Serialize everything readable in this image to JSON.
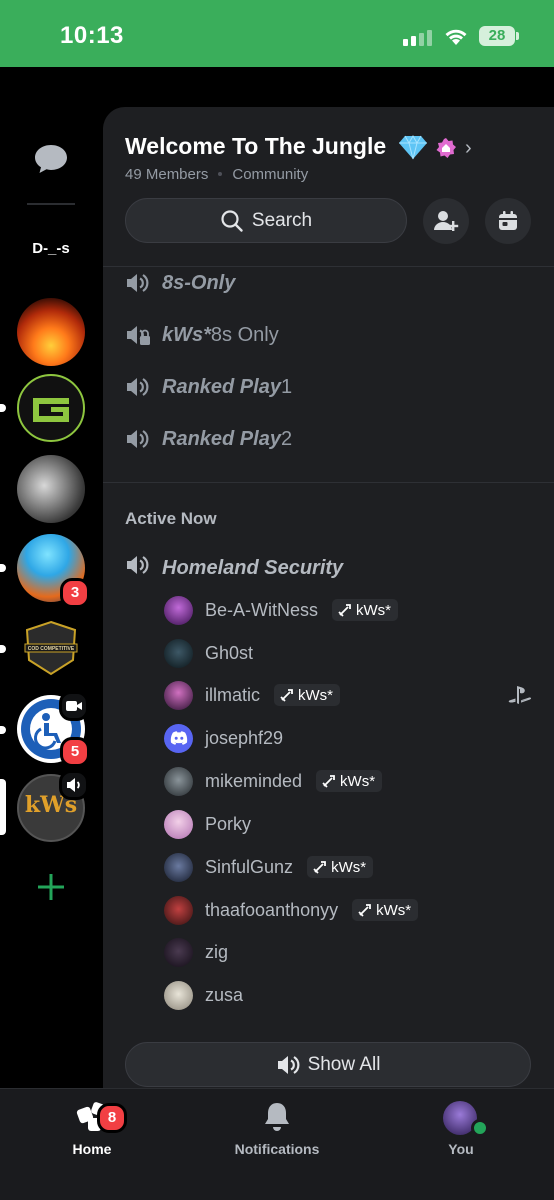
{
  "status_bar": {
    "time": "10:13",
    "battery": "28"
  },
  "rail": {
    "folder_label": "D-_-s",
    "servers": [
      {
        "name": "fire-server"
      },
      {
        "name": "optic-server"
      },
      {
        "name": "portrait-server"
      },
      {
        "name": "goku-server",
        "badge": "3"
      },
      {
        "name": "cod-competitive-server",
        "label": "COD COMPETITIVE"
      },
      {
        "name": "accessibility-server",
        "badge": "5"
      },
      {
        "name": "kws-server",
        "label": "kWs"
      }
    ]
  },
  "header": {
    "server_name": "Welcome To The Jungle",
    "members": "49 Members",
    "type": "Community",
    "search_label": "Search"
  },
  "channels": [
    {
      "prefix": "8s",
      "suffix": "-Only"
    },
    {
      "prefix": "kWs*",
      "suffix": " 8s Only"
    },
    {
      "prefix": "Ranked Play",
      "suffix": " 1"
    },
    {
      "prefix": "Ranked Play",
      "suffix": " 2"
    }
  ],
  "active_now": {
    "title": "Active Now",
    "voice_channel": "Homeland Security",
    "members": [
      {
        "name": "Be-A-WitNess",
        "tag": "kWs*",
        "avatar": "#6b2a8f"
      },
      {
        "name": "Gh0st",
        "avatar": "#1f3440"
      },
      {
        "name": "illmatic",
        "tag": "kWs*",
        "avatar": "#7a3a7a"
      },
      {
        "name": "josephf29",
        "avatar": "#5865f2"
      },
      {
        "name": "mikeminded",
        "tag": "kWs*",
        "avatar": "#5a6670"
      },
      {
        "name": "Porky",
        "avatar": "#c9a0c8"
      },
      {
        "name": "SinfulGunz",
        "tag": "kWs*",
        "avatar": "#2d3a55"
      },
      {
        "name": "thaafooanthonyy",
        "tag": "kWs*",
        "avatar": "#7a4040"
      },
      {
        "name": "zig",
        "avatar": "#2a2030"
      },
      {
        "name": "zusa",
        "avatar": "#b9b4a8"
      }
    ],
    "show_all_label": "Show All"
  },
  "bottom_nav": {
    "home": "Home",
    "home_badge": "8",
    "notifications": "Notifications",
    "you": "You"
  },
  "colors": {
    "status_bar": "#3aae5b",
    "panel": "#1e1f22",
    "badge": "#f23f43",
    "online": "#23a55a"
  }
}
